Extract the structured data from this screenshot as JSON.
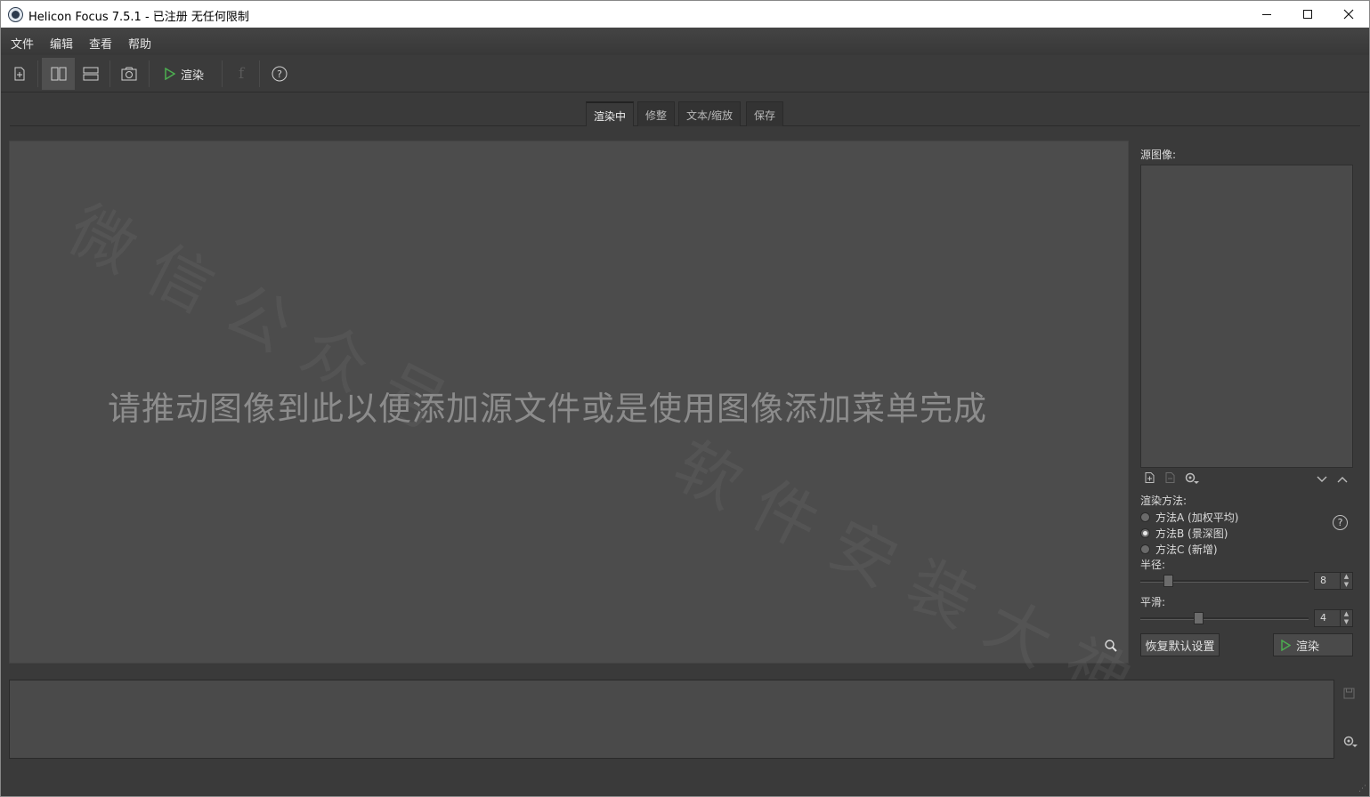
{
  "window": {
    "title": "Helicon Focus 7.5.1 - 已注册  无任何限制"
  },
  "menu": [
    "文件",
    "编辑",
    "查看",
    "帮助"
  ],
  "toolbar": {
    "render_label": "渲染"
  },
  "tabs": [
    {
      "label": "渲染中",
      "active": true
    },
    {
      "label": "修整",
      "active": false
    },
    {
      "label": "文本/缩放",
      "active": false
    },
    {
      "label": "保存",
      "active": false
    }
  ],
  "canvas": {
    "drop_hint": "请推动图像到此以便添加源文件或是使用图像添加菜单完成"
  },
  "watermark": {
    "line1": "微信公众号",
    "line2": "软件安装大神"
  },
  "right_panel": {
    "source_label": "源图像:",
    "method_label": "渲染方法:",
    "methods": [
      {
        "label": "方法A (加权平均)",
        "checked": false
      },
      {
        "label": "方法B (景深图)",
        "checked": true
      },
      {
        "label": "方法C (新增)",
        "checked": false
      }
    ],
    "radius_label": "半径:",
    "radius_value": "8",
    "smoothing_label": "平滑:",
    "smoothing_value": "4",
    "reset_button": "恢复默认设置",
    "render_button": "渲染"
  },
  "colors": {
    "accent_green": "#4caf50",
    "panel_bg": "#3a3a3a",
    "canvas_bg": "#4c4c4c"
  }
}
